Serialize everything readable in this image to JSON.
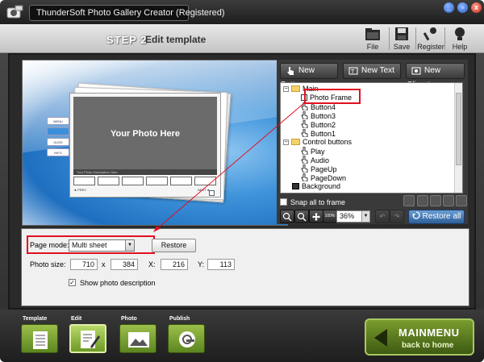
{
  "window": {
    "title": "ThunderSoft Photo Gallery Creator (Registered)",
    "min_label": "_",
    "max_label": "▫",
    "close_label": "x"
  },
  "header": {
    "step_number": "STEP 2",
    "step_title": "Edit template",
    "tools": [
      {
        "label": "File",
        "icon": "folder-icon"
      },
      {
        "label": "Save",
        "icon": "save-icon"
      },
      {
        "label": "Register",
        "icon": "key-icon"
      },
      {
        "label": "Help",
        "icon": "help-icon"
      }
    ]
  },
  "preview": {
    "photo_placeholder": "Your Photo Here",
    "photo_description": "Your Photo Description Here",
    "side_buttons": [
      "MENU",
      "",
      "SLIDE",
      "INFO"
    ],
    "nav_left": "◄ PREV",
    "nav_right": "NEXT ►"
  },
  "object_panel": {
    "new_button": "New Button",
    "new_text": "New Text",
    "new_clipart": "New Clipart",
    "tree": [
      {
        "label": "Main",
        "type": "folder",
        "level": 0,
        "expander": "−"
      },
      {
        "label": "Photo Frame",
        "type": "frame",
        "level": 1,
        "selected": true
      },
      {
        "label": "Button4",
        "type": "hand",
        "level": 1
      },
      {
        "label": "Button3",
        "type": "hand",
        "level": 1
      },
      {
        "label": "Button2",
        "type": "hand",
        "level": 1
      },
      {
        "label": "Button1",
        "type": "hand",
        "level": 1
      },
      {
        "label": "Control buttons",
        "type": "folder",
        "level": 0,
        "expander": "−"
      },
      {
        "label": "Play",
        "type": "hand",
        "level": 1
      },
      {
        "label": "Audio",
        "type": "hand",
        "level": 1
      },
      {
        "label": "PageUp",
        "type": "hand",
        "level": 1
      },
      {
        "label": "PageDown",
        "type": "hand",
        "level": 1
      },
      {
        "label": "Background",
        "type": "bg",
        "level": 0
      }
    ],
    "snap_label": "Snap all to frame",
    "zoom_value": "36%",
    "zoom_100_label": "100%",
    "restore_all_label": "Restore all"
  },
  "properties": {
    "page_mode_label": "Page mode:",
    "page_mode_value": "Multi sheet",
    "restore_label": "Restore",
    "photo_size_label": "Photo size:",
    "width": "710",
    "x_sep": "x",
    "height": "384",
    "x_label": "X:",
    "x_value": "216",
    "y_label": "Y:",
    "y_value": "113",
    "show_desc_label": "Show photo description",
    "show_desc_checked": true
  },
  "footer": {
    "tabs": [
      {
        "label": "Template",
        "active": false
      },
      {
        "label": "Edit",
        "active": true
      },
      {
        "label": "Photo",
        "active": false
      },
      {
        "label": "Publish",
        "active": false
      }
    ],
    "main_menu_line1": "MAINMENU",
    "main_menu_line2": "back to home"
  },
  "colors": {
    "highlight_red": "#e01020",
    "accent_green": "#6e9a26"
  }
}
